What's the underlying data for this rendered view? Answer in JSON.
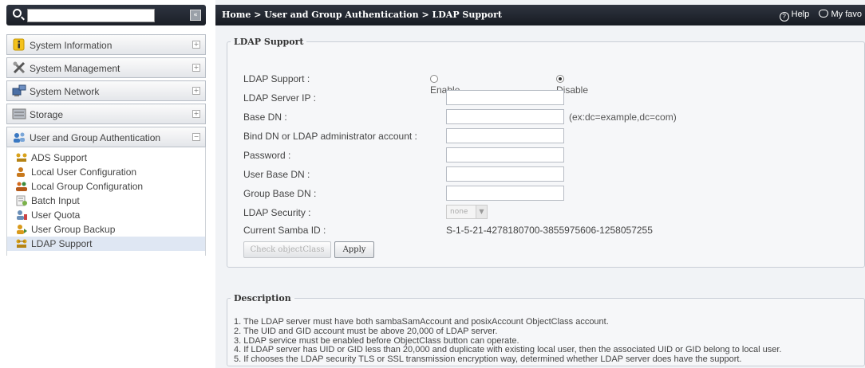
{
  "sidebar": {
    "search": {
      "value": "",
      "placeholder": ""
    },
    "collapse_label": "«",
    "menu": [
      {
        "label": "System Information",
        "toggle": "+"
      },
      {
        "label": "System Management",
        "toggle": "+"
      },
      {
        "label": "System Network",
        "toggle": "+"
      },
      {
        "label": "Storage",
        "toggle": "+"
      },
      {
        "label": "User and Group Authentication",
        "toggle": "−"
      }
    ],
    "submenu": [
      {
        "label": "ADS Support"
      },
      {
        "label": "Local User Configuration"
      },
      {
        "label": "Local Group Configuration"
      },
      {
        "label": "Batch Input"
      },
      {
        "label": "User Quota"
      },
      {
        "label": "User Group Backup"
      },
      {
        "label": "LDAP Support",
        "active": true
      }
    ]
  },
  "header": {
    "breadcrumb": "Home > User and Group Authentication > LDAP Support",
    "help_label": "Help",
    "favorite_label": "My favo"
  },
  "ldap": {
    "legend": "LDAP Support",
    "support_label": "LDAP Support :",
    "enable_label": "Enable",
    "disable_label": "Disable",
    "selected": "Disable",
    "server_ip_label": "LDAP Server IP :",
    "server_ip_value": "",
    "base_dn_label": "Base DN :",
    "base_dn_value": "",
    "base_dn_hint": "(ex:dc=example,dc=com)",
    "bind_dn_label": "Bind DN or LDAP administrator account :",
    "bind_dn_value": "",
    "password_label": "Password :",
    "password_value": "",
    "user_base_dn_label": "User Base DN :",
    "user_base_dn_value": "",
    "group_base_dn_label": "Group Base DN :",
    "group_base_dn_value": "",
    "security_label": "LDAP Security :",
    "security_value": "none",
    "samba_id_label": "Current Samba ID :",
    "samba_id_value": "S-1-5-21-4278180700-3855975606-1258057255",
    "check_button": "Check objectClass",
    "apply_button": "Apply"
  },
  "description": {
    "legend": "Description",
    "lines": [
      "1. The LDAP server must have both sambaSamAccount and posixAccount ObjectClass account.",
      "2. The UID and GID account must be above 20,000 of LDAP server.",
      "3. LDAP service must be enabled before ObjectClass button can operate.",
      "4. If LDAP server has UID or GID less than 20,000 and duplicate with existing local user, then the associated UID or GID belong to local user.",
      "5. If chooses the LDAP security TLS or SSL transmission encryption way, determined whether LDAP server does have the support."
    ]
  },
  "colors": {
    "header_bg": "#1b1f27",
    "active_item_bg": "#dfe7f3",
    "panel_bg": "#f1f3f6"
  }
}
